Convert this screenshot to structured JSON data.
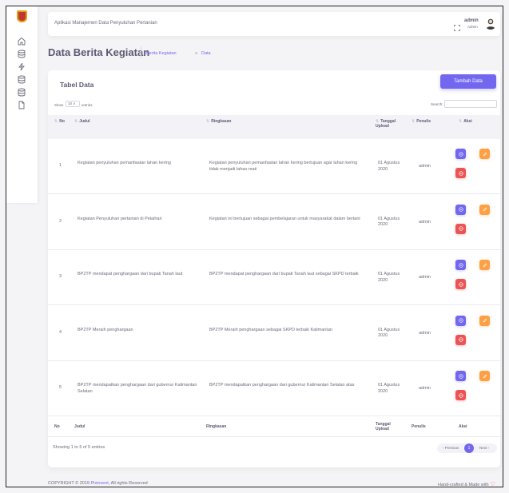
{
  "navbar": {
    "app_title": "Aplikasi Manajemen Data Penyuluhan Pertanian",
    "user_name": "admin",
    "user_role": "Admin"
  },
  "sidebar": {
    "items": [
      {
        "icon": "home-icon"
      },
      {
        "icon": "database-icon"
      },
      {
        "icon": "activity-icon"
      },
      {
        "icon": "database-icon"
      },
      {
        "icon": "database-icon"
      },
      {
        "icon": "file-icon"
      }
    ]
  },
  "page": {
    "title": "Data Berita Kegiatan",
    "breadcrumb_parent": "Berita Kegiatan",
    "breadcrumb_separator": "»",
    "breadcrumb_current": "Data"
  },
  "card": {
    "title": "Tabel Data",
    "add_button": "Tambah Data",
    "show_label": "Show",
    "length_value": "10 ∨",
    "entries_label": "entries",
    "search_label": "Search:"
  },
  "table": {
    "columns": {
      "no": "No",
      "judul": "Judul",
      "ringkasan": "Ringkasan",
      "tanggal": "Tanggal Upload",
      "penulis": "Penulis",
      "aksi": "Aksi"
    },
    "rows": [
      {
        "no": "1",
        "judul": "Kegiatan penyuluhan pemanfaatan lahan kering",
        "ringkasan": "Kegiatan penyuluhan pemanfaatan lahan kering bertujuan agar lahan kering tidak menjadi lahan mati",
        "tanggal": "01 Agustus 2020",
        "penulis": "admin"
      },
      {
        "no": "2",
        "judul": "Kegiatan Penyuluhan pertanian di Pelaihari",
        "ringkasan": "Kegiatan ini bertujuan sebagai pembelajaran untuk masyarakat dalam bertani",
        "tanggal": "01 Agustus 2020",
        "penulis": "admin"
      },
      {
        "no": "3",
        "judul": "BP2TP mendapat penghargaan dari bupati Tanah laut",
        "ringkasan": "BP2TP mendapat penghargaan dari bupati Tanah laut sebagai SKPD terbaik",
        "tanggal": "01 Agustus 2020",
        "penulis": "admin"
      },
      {
        "no": "4",
        "judul": "BP2TP Meraih penghargaan",
        "ringkasan": "BP2TP Meraih penghargaan sebagai SKPD terbaik Kalimantan",
        "tanggal": "01 Agustus 2020",
        "penulis": "admin"
      },
      {
        "no": "5",
        "judul": "BP2TP mendapatkan penghargaan dari gubernur Kalimantan Selatan",
        "ringkasan": "BP2TP mendapatkan penghargaan dari gubernur Kalimantan Selatan atas",
        "tanggal": "01 Agustus 2020",
        "penulis": "admin"
      }
    ],
    "info": "Showing 1 to 5 of 5 entries",
    "pagination": {
      "prev": "‹ Previous",
      "current": "1",
      "next": "Next ›"
    }
  },
  "footer": {
    "copyright_prefix": "COPYRIGHT © 2019 ",
    "brand": "Pixinvent",
    "copyright_suffix": ", All rights Reserved",
    "made_with": "Hand-crafted & Made with"
  },
  "colors": {
    "primary": "#7367f0",
    "warning": "#ff9f43",
    "danger": "#ea5455",
    "text": "#5e5873",
    "background": "#f4f4f6"
  }
}
